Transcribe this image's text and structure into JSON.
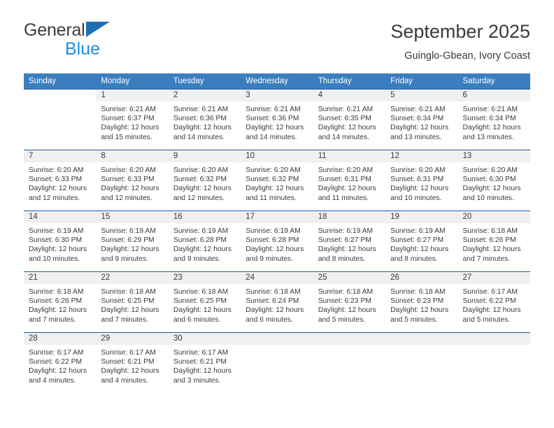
{
  "brand": {
    "line1": "General",
    "line2": "Blue",
    "triangle_color": "#1f6fb5",
    "blue_text_color": "#1f8ce0",
    "logo_icon": "triangle-logo-icon"
  },
  "header": {
    "title": "September 2025",
    "subtitle": "Guinglo-Gbean, Ivory Coast"
  },
  "theme": {
    "header_bg": "#3b7ec0",
    "row_border": "#1f5fa0",
    "daynum_bg": "#f0f0f0",
    "text": "#3a3a3a"
  },
  "weekdays": [
    "Sunday",
    "Monday",
    "Tuesday",
    "Wednesday",
    "Thursday",
    "Friday",
    "Saturday"
  ],
  "weeks": [
    [
      {
        "day": "",
        "sunrise": "",
        "sunset": "",
        "daylight_line1": "",
        "daylight_line2": "",
        "empty": true
      },
      {
        "day": "1",
        "sunrise": "Sunrise: 6:21 AM",
        "sunset": "Sunset: 6:37 PM",
        "daylight_line1": "Daylight: 12 hours",
        "daylight_line2": "and 15 minutes."
      },
      {
        "day": "2",
        "sunrise": "Sunrise: 6:21 AM",
        "sunset": "Sunset: 6:36 PM",
        "daylight_line1": "Daylight: 12 hours",
        "daylight_line2": "and 14 minutes."
      },
      {
        "day": "3",
        "sunrise": "Sunrise: 6:21 AM",
        "sunset": "Sunset: 6:36 PM",
        "daylight_line1": "Daylight: 12 hours",
        "daylight_line2": "and 14 minutes."
      },
      {
        "day": "4",
        "sunrise": "Sunrise: 6:21 AM",
        "sunset": "Sunset: 6:35 PM",
        "daylight_line1": "Daylight: 12 hours",
        "daylight_line2": "and 14 minutes."
      },
      {
        "day": "5",
        "sunrise": "Sunrise: 6:21 AM",
        "sunset": "Sunset: 6:34 PM",
        "daylight_line1": "Daylight: 12 hours",
        "daylight_line2": "and 13 minutes."
      },
      {
        "day": "6",
        "sunrise": "Sunrise: 6:21 AM",
        "sunset": "Sunset: 6:34 PM",
        "daylight_line1": "Daylight: 12 hours",
        "daylight_line2": "and 13 minutes."
      }
    ],
    [
      {
        "day": "7",
        "sunrise": "Sunrise: 6:20 AM",
        "sunset": "Sunset: 6:33 PM",
        "daylight_line1": "Daylight: 12 hours",
        "daylight_line2": "and 12 minutes."
      },
      {
        "day": "8",
        "sunrise": "Sunrise: 6:20 AM",
        "sunset": "Sunset: 6:33 PM",
        "daylight_line1": "Daylight: 12 hours",
        "daylight_line2": "and 12 minutes."
      },
      {
        "day": "9",
        "sunrise": "Sunrise: 6:20 AM",
        "sunset": "Sunset: 6:32 PM",
        "daylight_line1": "Daylight: 12 hours",
        "daylight_line2": "and 12 minutes."
      },
      {
        "day": "10",
        "sunrise": "Sunrise: 6:20 AM",
        "sunset": "Sunset: 6:32 PM",
        "daylight_line1": "Daylight: 12 hours",
        "daylight_line2": "and 11 minutes."
      },
      {
        "day": "11",
        "sunrise": "Sunrise: 6:20 AM",
        "sunset": "Sunset: 6:31 PM",
        "daylight_line1": "Daylight: 12 hours",
        "daylight_line2": "and 11 minutes."
      },
      {
        "day": "12",
        "sunrise": "Sunrise: 6:20 AM",
        "sunset": "Sunset: 6:31 PM",
        "daylight_line1": "Daylight: 12 hours",
        "daylight_line2": "and 10 minutes."
      },
      {
        "day": "13",
        "sunrise": "Sunrise: 6:20 AM",
        "sunset": "Sunset: 6:30 PM",
        "daylight_line1": "Daylight: 12 hours",
        "daylight_line2": "and 10 minutes."
      }
    ],
    [
      {
        "day": "14",
        "sunrise": "Sunrise: 6:19 AM",
        "sunset": "Sunset: 6:30 PM",
        "daylight_line1": "Daylight: 12 hours",
        "daylight_line2": "and 10 minutes."
      },
      {
        "day": "15",
        "sunrise": "Sunrise: 6:19 AM",
        "sunset": "Sunset: 6:29 PM",
        "daylight_line1": "Daylight: 12 hours",
        "daylight_line2": "and 9 minutes."
      },
      {
        "day": "16",
        "sunrise": "Sunrise: 6:19 AM",
        "sunset": "Sunset: 6:28 PM",
        "daylight_line1": "Daylight: 12 hours",
        "daylight_line2": "and 9 minutes."
      },
      {
        "day": "17",
        "sunrise": "Sunrise: 6:19 AM",
        "sunset": "Sunset: 6:28 PM",
        "daylight_line1": "Daylight: 12 hours",
        "daylight_line2": "and 9 minutes."
      },
      {
        "day": "18",
        "sunrise": "Sunrise: 6:19 AM",
        "sunset": "Sunset: 6:27 PM",
        "daylight_line1": "Daylight: 12 hours",
        "daylight_line2": "and 8 minutes."
      },
      {
        "day": "19",
        "sunrise": "Sunrise: 6:19 AM",
        "sunset": "Sunset: 6:27 PM",
        "daylight_line1": "Daylight: 12 hours",
        "daylight_line2": "and 8 minutes."
      },
      {
        "day": "20",
        "sunrise": "Sunrise: 6:18 AM",
        "sunset": "Sunset: 6:26 PM",
        "daylight_line1": "Daylight: 12 hours",
        "daylight_line2": "and 7 minutes."
      }
    ],
    [
      {
        "day": "21",
        "sunrise": "Sunrise: 6:18 AM",
        "sunset": "Sunset: 6:26 PM",
        "daylight_line1": "Daylight: 12 hours",
        "daylight_line2": "and 7 minutes."
      },
      {
        "day": "22",
        "sunrise": "Sunrise: 6:18 AM",
        "sunset": "Sunset: 6:25 PM",
        "daylight_line1": "Daylight: 12 hours",
        "daylight_line2": "and 7 minutes."
      },
      {
        "day": "23",
        "sunrise": "Sunrise: 6:18 AM",
        "sunset": "Sunset: 6:25 PM",
        "daylight_line1": "Daylight: 12 hours",
        "daylight_line2": "and 6 minutes."
      },
      {
        "day": "24",
        "sunrise": "Sunrise: 6:18 AM",
        "sunset": "Sunset: 6:24 PM",
        "daylight_line1": "Daylight: 12 hours",
        "daylight_line2": "and 6 minutes."
      },
      {
        "day": "25",
        "sunrise": "Sunrise: 6:18 AM",
        "sunset": "Sunset: 6:23 PM",
        "daylight_line1": "Daylight: 12 hours",
        "daylight_line2": "and 5 minutes."
      },
      {
        "day": "26",
        "sunrise": "Sunrise: 6:18 AM",
        "sunset": "Sunset: 6:23 PM",
        "daylight_line1": "Daylight: 12 hours",
        "daylight_line2": "and 5 minutes."
      },
      {
        "day": "27",
        "sunrise": "Sunrise: 6:17 AM",
        "sunset": "Sunset: 6:22 PM",
        "daylight_line1": "Daylight: 12 hours",
        "daylight_line2": "and 5 minutes."
      }
    ],
    [
      {
        "day": "28",
        "sunrise": "Sunrise: 6:17 AM",
        "sunset": "Sunset: 6:22 PM",
        "daylight_line1": "Daylight: 12 hours",
        "daylight_line2": "and 4 minutes."
      },
      {
        "day": "29",
        "sunrise": "Sunrise: 6:17 AM",
        "sunset": "Sunset: 6:21 PM",
        "daylight_line1": "Daylight: 12 hours",
        "daylight_line2": "and 4 minutes."
      },
      {
        "day": "30",
        "sunrise": "Sunrise: 6:17 AM",
        "sunset": "Sunset: 6:21 PM",
        "daylight_line1": "Daylight: 12 hours",
        "daylight_line2": "and 3 minutes."
      },
      {
        "day": "",
        "sunrise": "",
        "sunset": "",
        "daylight_line1": "",
        "daylight_line2": "",
        "empty": true
      },
      {
        "day": "",
        "sunrise": "",
        "sunset": "",
        "daylight_line1": "",
        "daylight_line2": "",
        "empty": true
      },
      {
        "day": "",
        "sunrise": "",
        "sunset": "",
        "daylight_line1": "",
        "daylight_line2": "",
        "empty": true
      },
      {
        "day": "",
        "sunrise": "",
        "sunset": "",
        "daylight_line1": "",
        "daylight_line2": "",
        "empty": true
      }
    ]
  ]
}
